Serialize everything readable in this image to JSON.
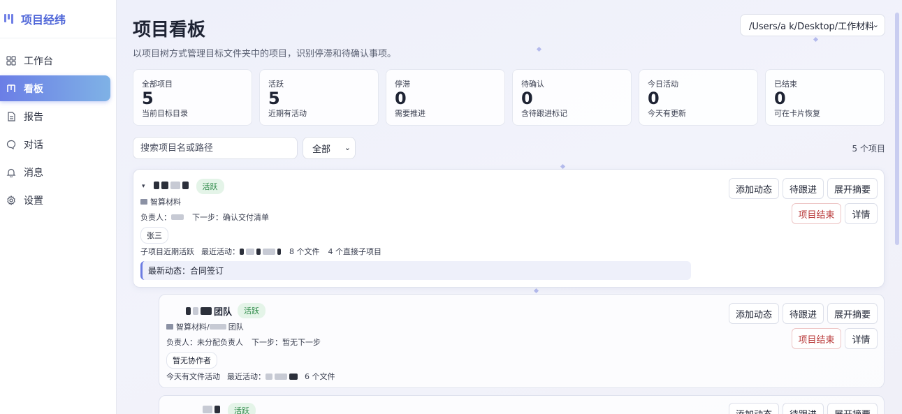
{
  "app": {
    "title": "项目经纬"
  },
  "sidebar": {
    "items": [
      {
        "label": "工作台",
        "icon": "dashboard-icon"
      },
      {
        "label": "看板",
        "icon": "kanban-icon",
        "active": true
      },
      {
        "label": "报告",
        "icon": "document-icon"
      },
      {
        "label": "对话",
        "icon": "chat-icon"
      },
      {
        "label": "消息",
        "icon": "bell-icon"
      },
      {
        "label": "设置",
        "icon": "gear-icon"
      }
    ]
  },
  "header": {
    "title": "项目看板",
    "subtitle": "以项目树方式管理目标文件夹中的项目，识别停滞和待确认事项。",
    "path_value": "/Users/a  k/Desktop/工作材料"
  },
  "stats": [
    {
      "label": "全部项目",
      "value": "5",
      "hint": "当前目标目录"
    },
    {
      "label": "活跃",
      "value": "5",
      "hint": "近期有活动"
    },
    {
      "label": "停滞",
      "value": "0",
      "hint": "需要推进"
    },
    {
      "label": "待确认",
      "value": "0",
      "hint": "含待跟进标记"
    },
    {
      "label": "今日活动",
      "value": "0",
      "hint": "今天有更新"
    },
    {
      "label": "已结束",
      "value": "0",
      "hint": "可在卡片恢复"
    }
  ],
  "toolbar": {
    "search_placeholder": "搜索项目名或路径",
    "filter_value": "全部",
    "count_text": "5 个项目"
  },
  "actions": {
    "add_update": "添加动态",
    "follow_up": "待跟进",
    "expand_summary": "展开摘要",
    "end_project": "项目结束",
    "details": "详情"
  },
  "projects": [
    {
      "status": "活跃",
      "path": "智算材料",
      "owner_label": "负责人：",
      "next_step": "下一步：确认交付清单",
      "collaborator": "张三",
      "activity_note": "子项目近期活跃",
      "recent_label": "最近活动：",
      "files": "8 个文件",
      "children": "4 个直接子项目",
      "latest": "最新动态：合同签订"
    },
    {
      "name_suffix": "团队",
      "status": "活跃",
      "path": "智算材料/",
      "path_suffix": "团队",
      "owner": "负责人：未分配负责人",
      "next_step": "下一步：暂无下一步",
      "collaborator": "暂无协作者",
      "activity_note": "今天有文件活动",
      "recent_label": "最近活动：",
      "files": "6 个文件"
    },
    {
      "status": "活跃"
    }
  ],
  "colors": {
    "accent": "#6b7ee6",
    "active_badge": "#2f8a4a",
    "danger": "#b93a3a"
  }
}
